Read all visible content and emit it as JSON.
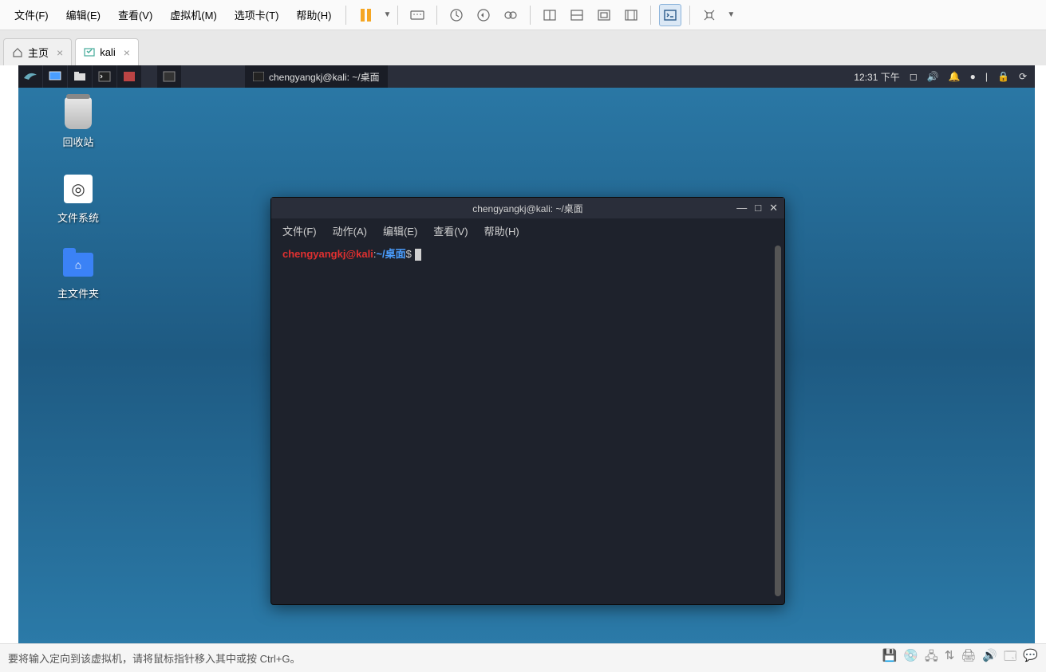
{
  "vm_menu": {
    "file": "文件(F)",
    "edit": "编辑(E)",
    "view": "查看(V)",
    "vm": "虚拟机(M)",
    "tabs": "选项卡(T)",
    "help": "帮助(H)"
  },
  "vm_tabs": {
    "home": "主页",
    "kali": "kali"
  },
  "kali_panel": {
    "taskbar_title": "chengyangkj@kali: ~/桌面",
    "time": "12:31 下午"
  },
  "desktop_icons": {
    "trash": "回收站",
    "filesystem": "文件系统",
    "home": "主文件夹"
  },
  "terminal": {
    "title": "chengyangkj@kali: ~/桌面",
    "menu": {
      "file": "文件(F)",
      "action": "动作(A)",
      "edit": "编辑(E)",
      "view": "查看(V)",
      "help": "帮助(H)"
    },
    "prompt_user": "chengyangkj@kali",
    "prompt_colon": ":",
    "prompt_path": "~/桌面",
    "prompt_dollar": "$"
  },
  "status": {
    "hint": "要将输入定向到该虚拟机，请将鼠标指针移入其中或按 Ctrl+G。"
  }
}
